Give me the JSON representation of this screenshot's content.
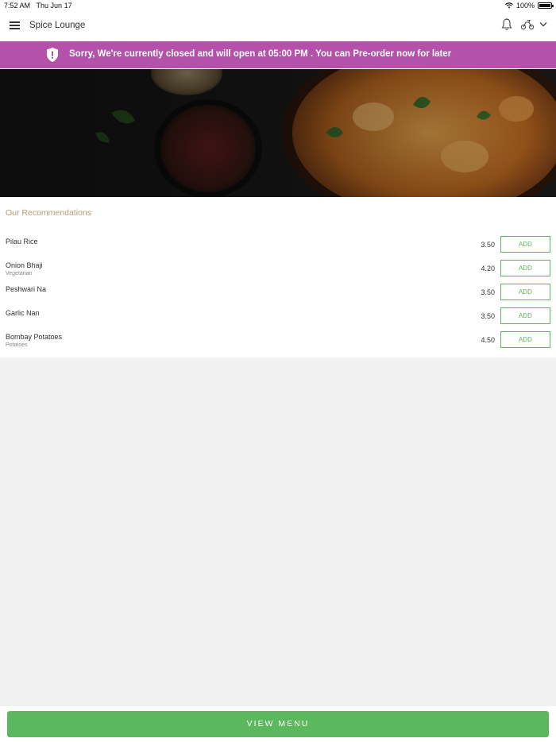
{
  "status_bar": {
    "time": "7:52 AM",
    "date": "Thu Jun 17",
    "battery": "100%"
  },
  "header": {
    "title": "Spice Lounge"
  },
  "banner": {
    "message": "Sorry, We're currently closed and will open at 05:00 PM . You can Pre-order now for later",
    "color": "#b452aa"
  },
  "recommendations": {
    "heading": "Our Recommendations",
    "items": [
      {
        "name": "Pilau Rice",
        "subtitle": "",
        "price": "3.50",
        "button": "ADD"
      },
      {
        "name": "Onion Bhaji",
        "subtitle": "Vegetarian",
        "price": "4.20",
        "button": "ADD"
      },
      {
        "name": "Peshwari Na",
        "subtitle": "",
        "price": "3.50",
        "button": "ADD"
      },
      {
        "name": "Garlic Nan",
        "subtitle": "",
        "price": "3.50",
        "button": "ADD"
      },
      {
        "name": "Bombay Potatoes",
        "subtitle": "Potatoes",
        "price": "4.50",
        "button": "ADD"
      }
    ]
  },
  "footer": {
    "view_menu_label": "VIEW MENU",
    "accent": "#5cb85c"
  }
}
